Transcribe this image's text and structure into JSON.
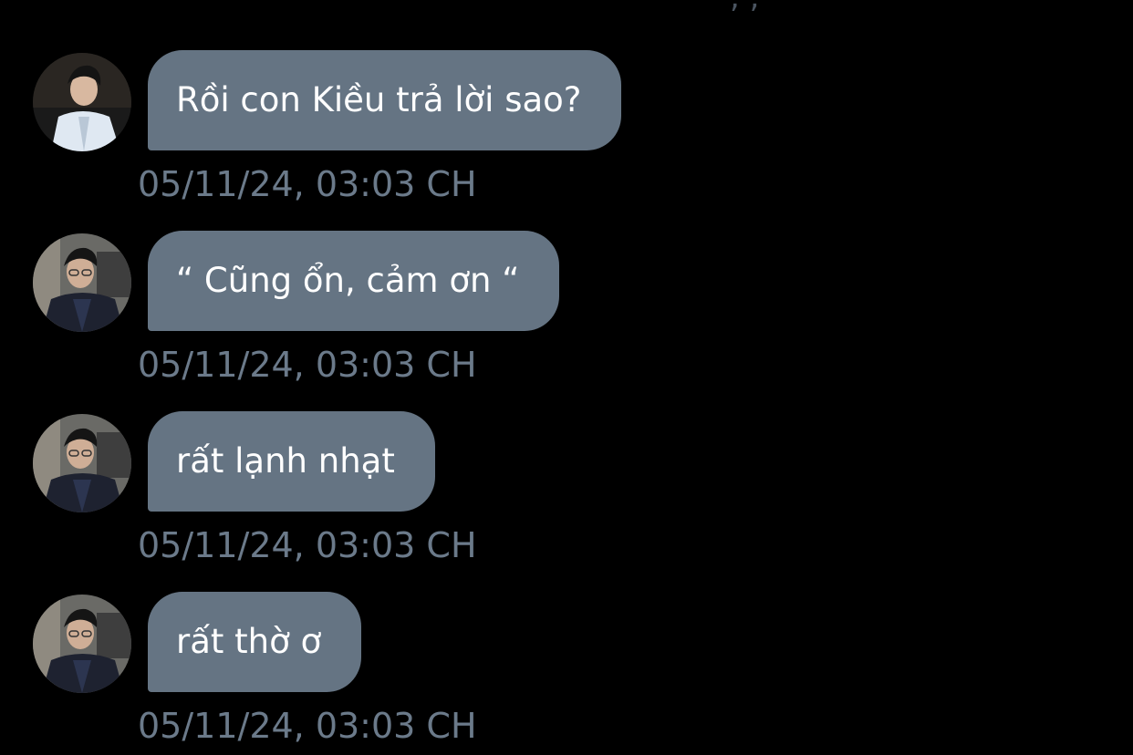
{
  "messages": [
    {
      "text": "Rồi con Kiều trả lời sao?",
      "time": "05/11/24, 03:03 CH",
      "avatar": "avatar-white-shirt"
    },
    {
      "text": "“ Cũng ổn, cảm ơn “",
      "time": "05/11/24, 03:03 CH",
      "avatar": "avatar-dark-jacket-glasses"
    },
    {
      "text": "rất lạnh nhạt",
      "time": "05/11/24, 03:03 CH",
      "avatar": "avatar-dark-jacket-glasses"
    },
    {
      "text": "rất thờ ơ",
      "time": "05/11/24, 03:03 CH",
      "avatar": "avatar-dark-jacket-glasses"
    }
  ],
  "colors": {
    "background": "#000000",
    "bubble": "#657483",
    "bubble_text": "#ffffff",
    "timestamp": "#6b7a8a"
  }
}
